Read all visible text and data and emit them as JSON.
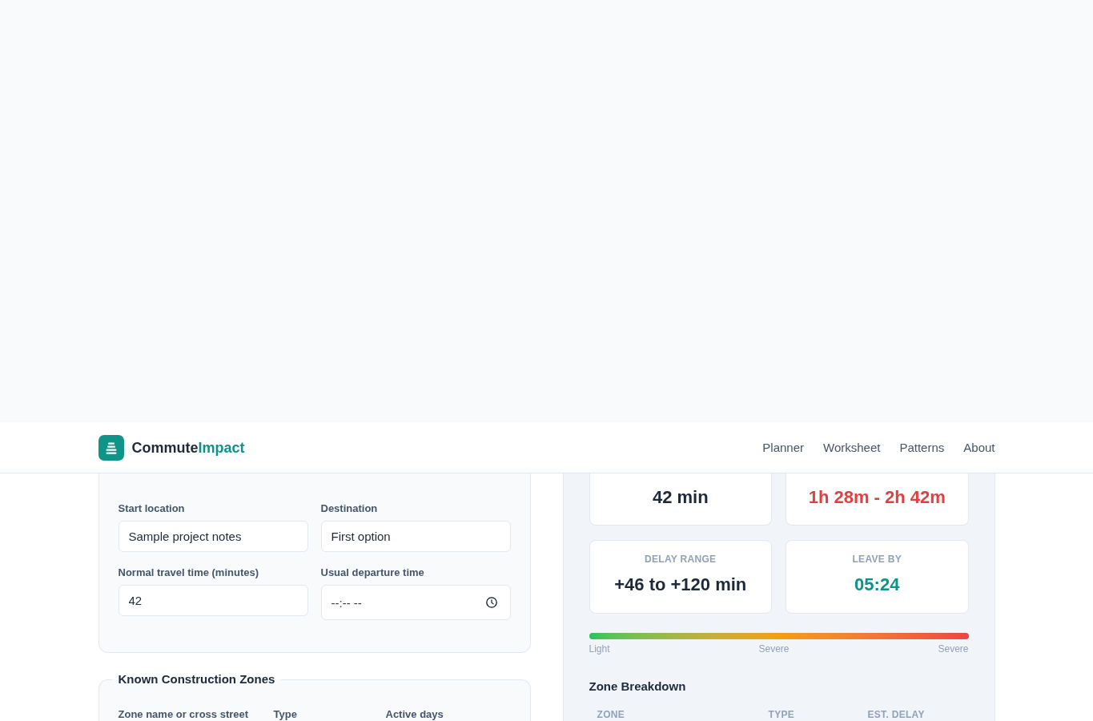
{
  "header": {
    "brand": {
      "name": "Commute",
      "accent": "Impact"
    },
    "nav": [
      {
        "label": "Planner"
      },
      {
        "label": "Worksheet"
      },
      {
        "label": "Patterns"
      },
      {
        "label": "About"
      }
    ]
  },
  "route_form": {
    "fields": [
      {
        "kind": "text",
        "label": "Start location",
        "value": "Sample project notes"
      },
      {
        "kind": "text",
        "label": "Destination",
        "value": "First option"
      },
      {
        "kind": "text",
        "label": "Normal travel time (minutes)",
        "value": "42"
      },
      {
        "kind": "time",
        "label": "Usual departure time",
        "placeholder": "--:-- --"
      }
    ]
  },
  "construction_zones": {
    "title": "Known Construction Zones",
    "columns": [
      "Zone name or cross street",
      "Type",
      "Active days"
    ]
  },
  "summary": {
    "metrics": [
      {
        "value": "42 min",
        "color": "#1e293b"
      },
      {
        "value": "1h 28m - 2h 42m",
        "color": "#e53e3e"
      },
      {
        "label": "DELAY RANGE",
        "value": "+46 to +120 min",
        "color": "#1e293b"
      },
      {
        "label": "LEAVE BY",
        "value": "05:24",
        "color": "#0d9488"
      }
    ],
    "severity_scale": {
      "labels": [
        "Light",
        "Severe",
        "Severe"
      ]
    },
    "breakdown": {
      "title": "Zone Breakdown",
      "columns": [
        "ZONE",
        "TYPE",
        "EST. DELAY"
      ]
    }
  }
}
